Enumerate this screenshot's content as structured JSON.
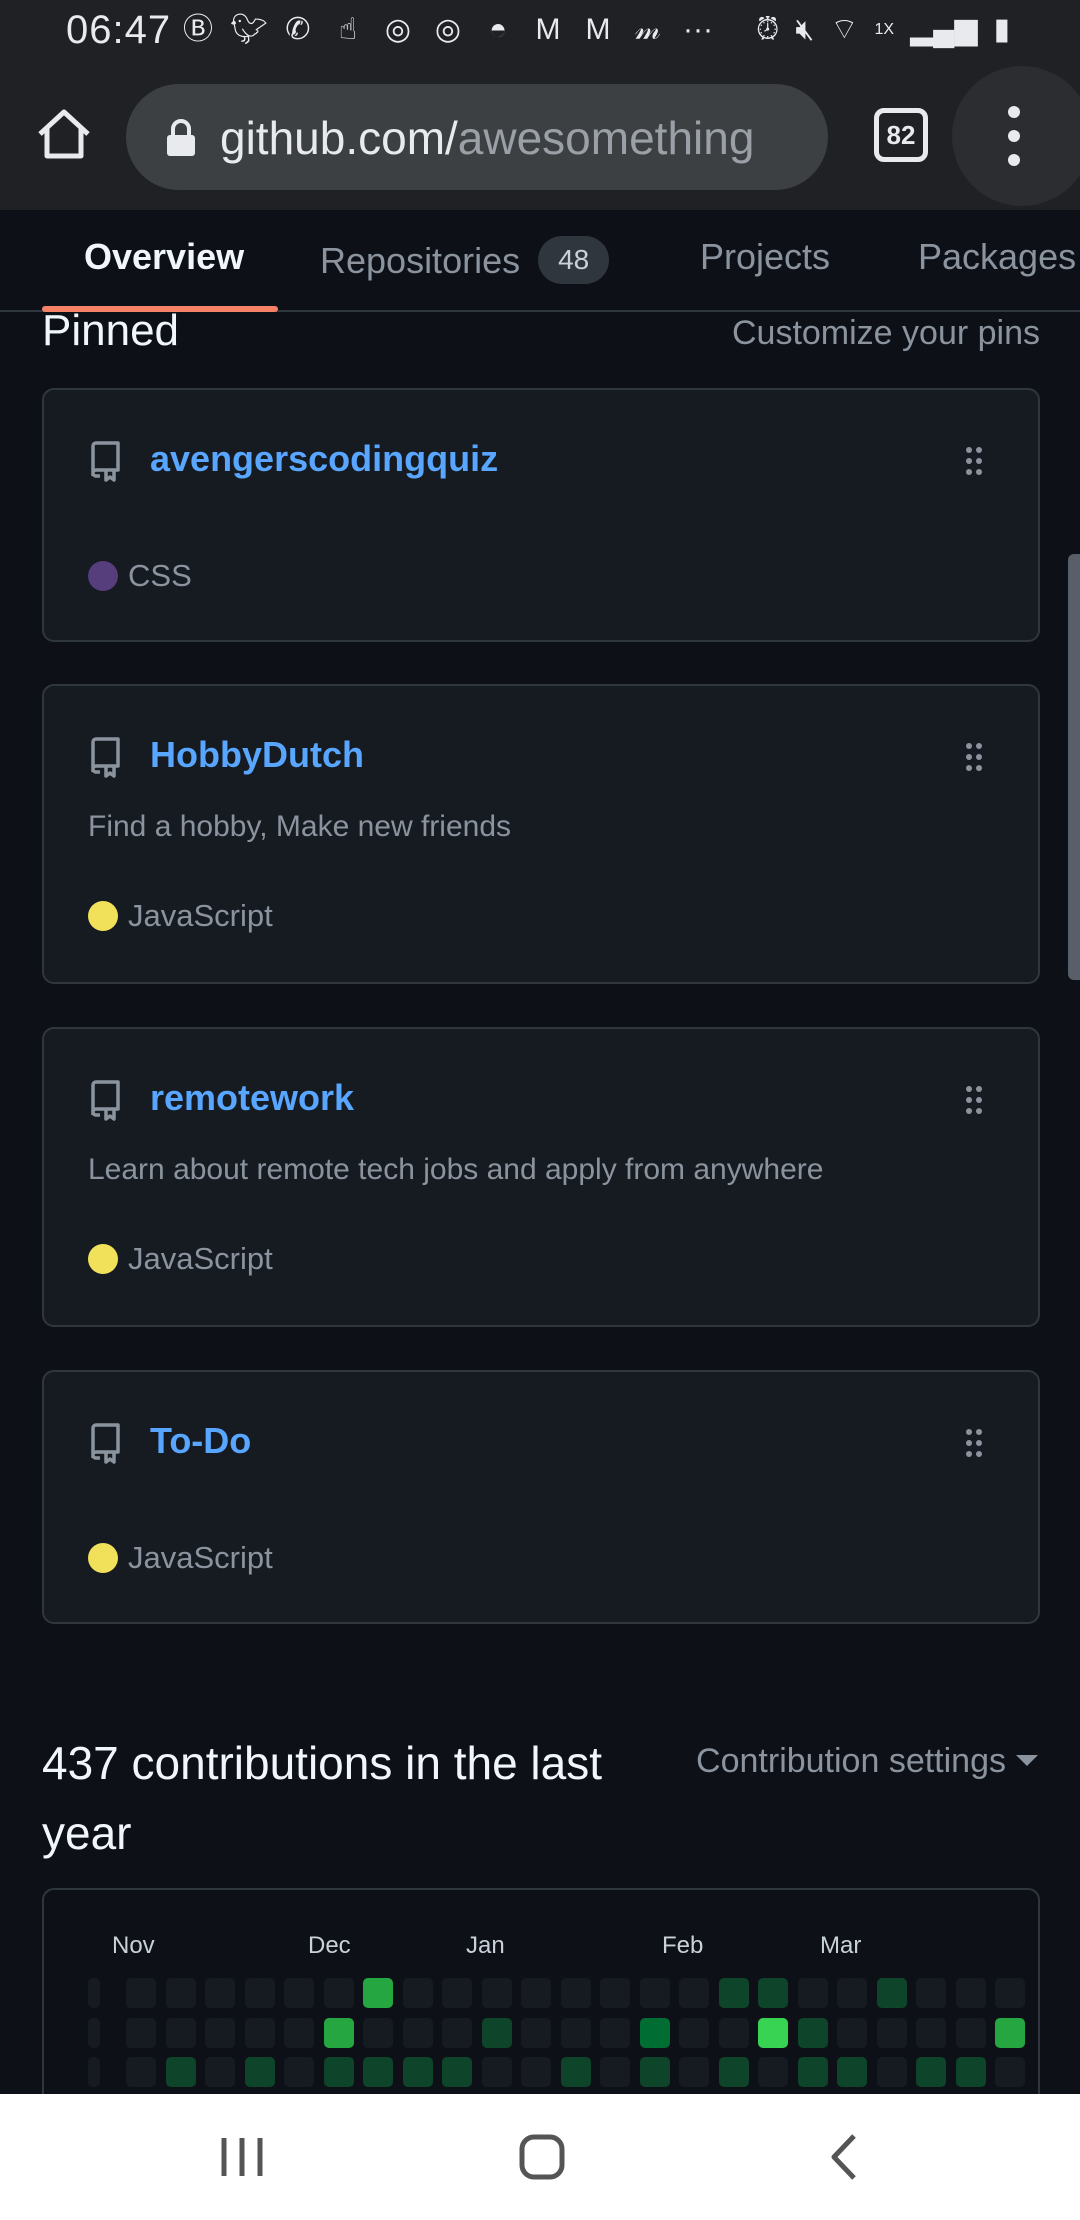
{
  "status_bar": {
    "time": "06:47",
    "app_icons": [
      "B",
      "twitter-icon",
      "phone-icon",
      "hand-icon",
      "instagram-icon",
      "instagram-icon",
      "arch-icon",
      "gmail-icon",
      "gmail-icon",
      "m-icon"
    ],
    "more": "···",
    "speed": "1X",
    "right_icons": [
      "alarm-icon",
      "mute-icon",
      "wifi-icon",
      "signal-icon",
      "battery-icon"
    ]
  },
  "browser": {
    "url_domain": "github.com/",
    "url_path": "awesomething",
    "tab_count": "82"
  },
  "nav": {
    "tabs": [
      {
        "label": "Overview"
      },
      {
        "label": "Repositories",
        "count": "48"
      },
      {
        "label": "Projects"
      },
      {
        "label": "Packages"
      }
    ]
  },
  "pinned": {
    "title": "Pinned",
    "customize_label": "Customize your pins",
    "repos": [
      {
        "name": "avengerscodingquiz",
        "description": "",
        "language": "CSS",
        "language_color": "#563d7c"
      },
      {
        "name": "HobbyDutch",
        "description": "Find a hobby, Make new friends",
        "language": "JavaScript",
        "language_color": "#f1e05a"
      },
      {
        "name": "remotework",
        "description": "Learn about remote tech jobs and apply from anywhere",
        "language": "JavaScript",
        "language_color": "#f1e05a"
      },
      {
        "name": "To-Do",
        "description": "",
        "language": "JavaScript",
        "language_color": "#f1e05a"
      }
    ]
  },
  "contributions": {
    "title": "437 contributions in the last year",
    "settings_label": "Contribution settings",
    "months": [
      "Nov",
      "Dec",
      "Jan",
      "Feb",
      "Mar"
    ],
    "level_colors": [
      "#161b22",
      "#0e4429",
      "#006d32",
      "#26a641",
      "#39d353"
    ],
    "grid_rows": [
      [
        0,
        0,
        0,
        0,
        0,
        0,
        3,
        0,
        0,
        0,
        0,
        0,
        0,
        0,
        0,
        1,
        1,
        0,
        0,
        1,
        0,
        0,
        0
      ],
      [
        0,
        0,
        0,
        0,
        0,
        3,
        0,
        0,
        0,
        1,
        0,
        0,
        0,
        2,
        0,
        0,
        4,
        1,
        0,
        0,
        0,
        0,
        3
      ],
      [
        0,
        1,
        0,
        1,
        0,
        1,
        1,
        1,
        1,
        0,
        0,
        1,
        0,
        1,
        0,
        1,
        0,
        1,
        1,
        0,
        1,
        1,
        0
      ]
    ]
  }
}
